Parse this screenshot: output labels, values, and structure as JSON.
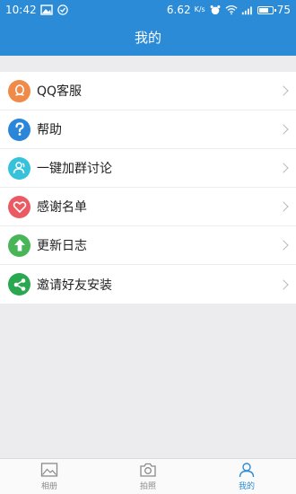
{
  "status_bar": {
    "time": "10:42",
    "network_speed": "6.62",
    "network_unit": "K/s",
    "battery": "75",
    "battery_fraction": 0.75
  },
  "header": {
    "title": "我的"
  },
  "menu": {
    "items": [
      {
        "label": "QQ客服",
        "icon": "qq-penguin-icon",
        "color": "#f08a48"
      },
      {
        "label": "帮助",
        "icon": "question-mark-icon",
        "color": "#2b86d9"
      },
      {
        "label": "一键加群讨论",
        "icon": "user-group-icon",
        "color": "#37c2db"
      },
      {
        "label": "感谢名单",
        "icon": "heart-icon",
        "color": "#eb5a62"
      },
      {
        "label": "更新日志",
        "icon": "arrow-up-icon",
        "color": "#49b557"
      },
      {
        "label": "邀请好友安装",
        "icon": "share-icon",
        "color": "#2aa850"
      }
    ]
  },
  "bottom_nav": {
    "tabs": [
      {
        "label": "相册",
        "icon": "album-icon",
        "active": false
      },
      {
        "label": "拍照",
        "icon": "camera-icon",
        "active": false
      },
      {
        "label": "我的",
        "icon": "person-icon",
        "active": true
      }
    ]
  },
  "colors": {
    "accent": "#2b8bd6",
    "background": "#ececee"
  }
}
